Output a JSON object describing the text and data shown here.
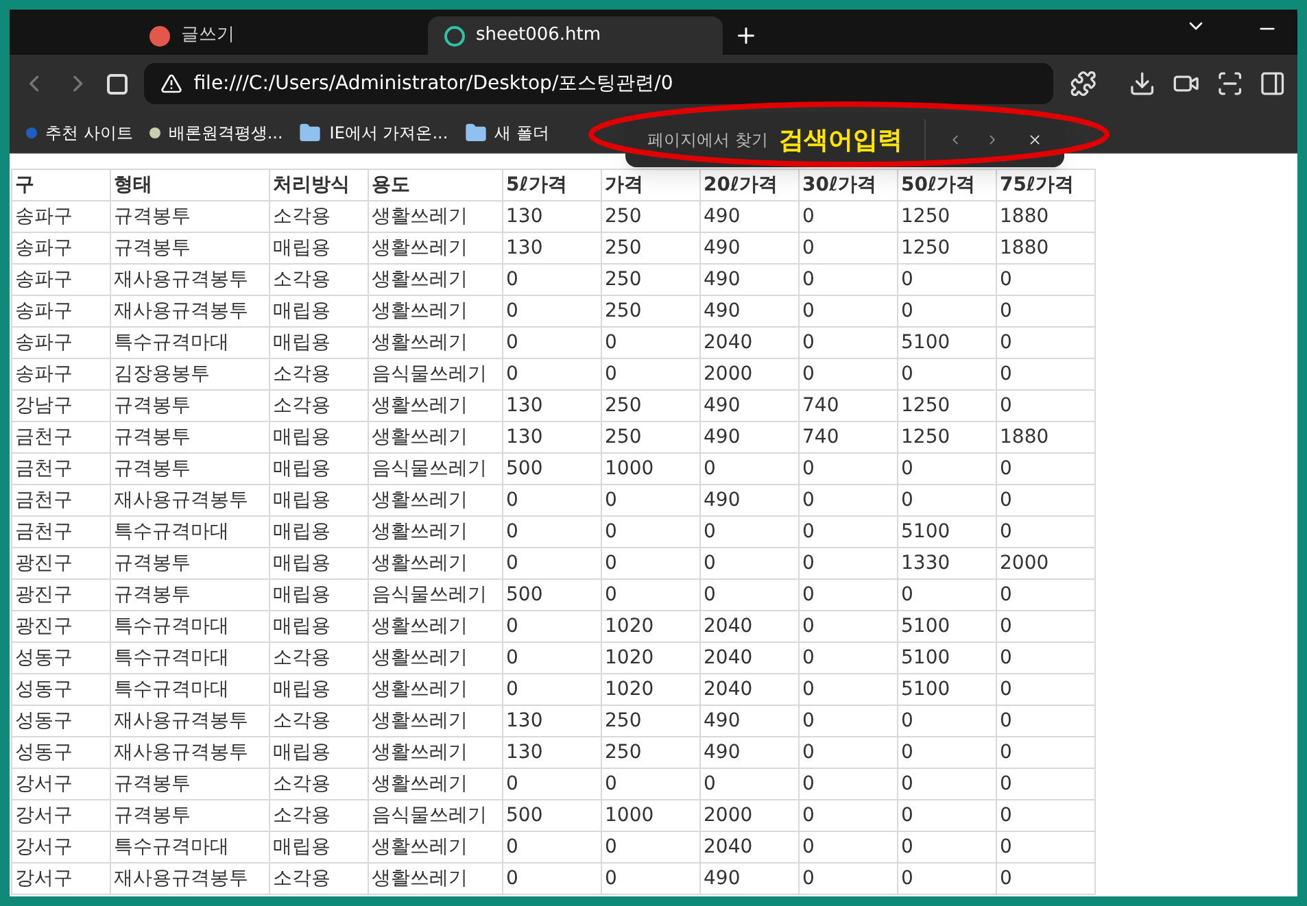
{
  "tabs": [
    {
      "label": "글쓰기",
      "selected": false
    },
    {
      "label": "sheet006.htm",
      "selected": true
    }
  ],
  "address_bar": {
    "value": "file:///C:/Users/Administrator/Desktop/포스팅관련/0"
  },
  "bookmarks": [
    {
      "label": "추천 사이트",
      "kind": "dot",
      "color": "#1e5fbf"
    },
    {
      "label": "배론원격평생...",
      "kind": "dot",
      "color": "#c9cfb0"
    },
    {
      "label": "IE에서 가져온...",
      "kind": "folder"
    },
    {
      "label": "새 폴더",
      "kind": "folder"
    }
  ],
  "find_bar": {
    "label": "페이지에서 찾기",
    "value": "검색어입력"
  },
  "table": {
    "columns": [
      "구",
      "형태",
      "처리방식",
      "용도",
      "5ℓ가격",
      "가격",
      "20ℓ가격",
      "30ℓ가격",
      "50ℓ가격",
      "75ℓ가격"
    ],
    "rows": [
      [
        "송파구",
        "규격봉투",
        "소각용",
        "생활쓰레기",
        "130",
        "250",
        "490",
        "0",
        "1250",
        "1880"
      ],
      [
        "송파구",
        "규격봉투",
        "매립용",
        "생활쓰레기",
        "130",
        "250",
        "490",
        "0",
        "1250",
        "1880"
      ],
      [
        "송파구",
        "재사용규격봉투",
        "소각용",
        "생활쓰레기",
        "0",
        "250",
        "490",
        "0",
        "0",
        "0"
      ],
      [
        "송파구",
        "재사용규격봉투",
        "매립용",
        "생활쓰레기",
        "0",
        "250",
        "490",
        "0",
        "0",
        "0"
      ],
      [
        "송파구",
        "특수규격마대",
        "매립용",
        "생활쓰레기",
        "0",
        "0",
        "2040",
        "0",
        "5100",
        "0"
      ],
      [
        "송파구",
        "김장용봉투",
        "소각용",
        "음식물쓰레기",
        "0",
        "0",
        "2000",
        "0",
        "0",
        "0"
      ],
      [
        "강남구",
        "규격봉투",
        "소각용",
        "생활쓰레기",
        "130",
        "250",
        "490",
        "740",
        "1250",
        "0"
      ],
      [
        "금천구",
        "규격봉투",
        "매립용",
        "생활쓰레기",
        "130",
        "250",
        "490",
        "740",
        "1250",
        "1880"
      ],
      [
        "금천구",
        "규격봉투",
        "매립용",
        "음식물쓰레기",
        "500",
        "1000",
        "0",
        "0",
        "0",
        "0"
      ],
      [
        "금천구",
        "재사용규격봉투",
        "매립용",
        "생활쓰레기",
        "0",
        "0",
        "490",
        "0",
        "0",
        "0"
      ],
      [
        "금천구",
        "특수규격마대",
        "매립용",
        "생활쓰레기",
        "0",
        "0",
        "0",
        "0",
        "5100",
        "0"
      ],
      [
        "광진구",
        "규격봉투",
        "매립용",
        "생활쓰레기",
        "0",
        "0",
        "0",
        "0",
        "1330",
        "2000"
      ],
      [
        "광진구",
        "규격봉투",
        "매립용",
        "음식물쓰레기",
        "500",
        "0",
        "0",
        "0",
        "0",
        "0"
      ],
      [
        "광진구",
        "특수규격마대",
        "매립용",
        "생활쓰레기",
        "0",
        "1020",
        "2040",
        "0",
        "5100",
        "0"
      ],
      [
        "성동구",
        "특수규격마대",
        "소각용",
        "생활쓰레기",
        "0",
        "1020",
        "2040",
        "0",
        "5100",
        "0"
      ],
      [
        "성동구",
        "특수규격마대",
        "매립용",
        "생활쓰레기",
        "0",
        "1020",
        "2040",
        "0",
        "5100",
        "0"
      ],
      [
        "성동구",
        "재사용규격봉투",
        "소각용",
        "생활쓰레기",
        "130",
        "250",
        "490",
        "0",
        "0",
        "0"
      ],
      [
        "성동구",
        "재사용규격봉투",
        "매립용",
        "생활쓰레기",
        "130",
        "250",
        "490",
        "0",
        "0",
        "0"
      ],
      [
        "강서구",
        "규격봉투",
        "소각용",
        "생활쓰레기",
        "0",
        "0",
        "0",
        "0",
        "0",
        "0"
      ],
      [
        "강서구",
        "규격봉투",
        "소각용",
        "음식물쓰레기",
        "500",
        "1000",
        "2000",
        "0",
        "0",
        "0"
      ],
      [
        "강서구",
        "특수규격마대",
        "매립용",
        "생활쓰레기",
        "0",
        "0",
        "2040",
        "0",
        "0",
        "0"
      ],
      [
        "강서구",
        "재사용규격봉투",
        "소각용",
        "생활쓰레기",
        "0",
        "0",
        "490",
        "0",
        "0",
        "0"
      ]
    ]
  }
}
